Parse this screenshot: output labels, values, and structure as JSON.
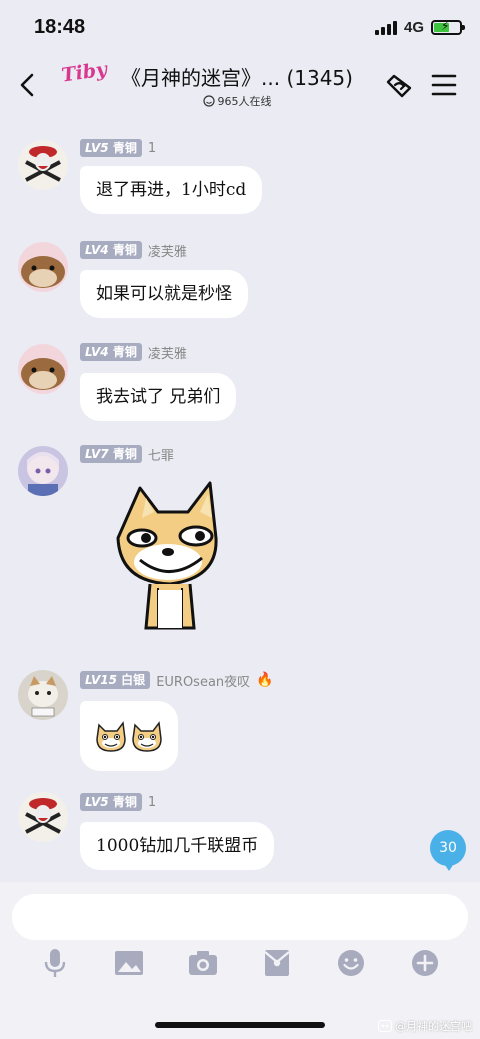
{
  "status": {
    "time": "18:48",
    "network": "4G"
  },
  "header": {
    "logo_text": "Tiby",
    "title": "《月神的迷宫》... (1345)",
    "online": "965人在线"
  },
  "messages": [
    {
      "level": "LV5",
      "rank": "青铜",
      "nick": "1",
      "text": "退了再进，1小时cd"
    },
    {
      "level": "LV4",
      "rank": "青铜",
      "nick": "凌芙雅",
      "text": "如果可以就是秒怪"
    },
    {
      "level": "LV4",
      "rank": "青铜",
      "nick": "凌芙雅",
      "text": "我去试了 兄弟们"
    },
    {
      "level": "LV7",
      "rank": "青铜",
      "nick": "七罪"
    },
    {
      "level": "LV15",
      "rank": "白银",
      "nick": "EUROsean夜叹"
    },
    {
      "level": "LV5",
      "rank": "青铜",
      "nick": "1",
      "text": "1000钻加几千联盟币"
    }
  ],
  "unread_badge": "30",
  "watermark": "@月神的迷宫吧",
  "colors": {
    "accent": "#4ab0e8",
    "level_badge": "#a8acc0",
    "background": "#ebebf3"
  }
}
